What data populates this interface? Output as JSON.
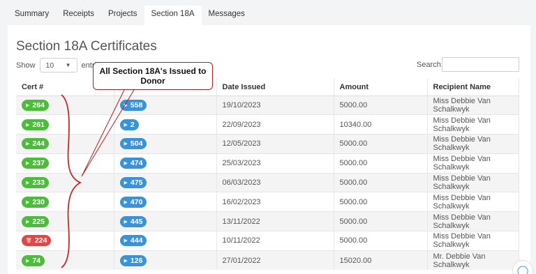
{
  "tabs": [
    {
      "label": "Summary"
    },
    {
      "label": "Receipts"
    },
    {
      "label": "Projects"
    },
    {
      "label": "Section 18A"
    },
    {
      "label": "Messages"
    }
  ],
  "page_title": "Section 18A Certificates",
  "length": {
    "show_label": "Show",
    "selected": "10",
    "entries_label": "entries"
  },
  "search": {
    "label": "Search:",
    "value": ""
  },
  "callout": {
    "line1": "All Section 18A's Issued to",
    "line2": "Donor"
  },
  "table": {
    "columns": [
      "Cert #",
      "",
      "Date Issued",
      "Amount",
      "Recipient Name"
    ],
    "rows": [
      {
        "cert": "264",
        "cert_color": "green",
        "ref": "558",
        "date": "19/10/2023",
        "amount": "5000.00",
        "recipient": "Miss Debbie Van Schalkwyk"
      },
      {
        "cert": "261",
        "cert_color": "green",
        "ref": "2",
        "date": "22/09/2023",
        "amount": "10340.00",
        "recipient": "Miss Debbie Van Schalkwyk"
      },
      {
        "cert": "244",
        "cert_color": "green",
        "ref": "504",
        "date": "12/05/2023",
        "amount": "5000.00",
        "recipient": "Miss Debbie Van Schalkwyk"
      },
      {
        "cert": "237",
        "cert_color": "green",
        "ref": "474",
        "date": "25/03/2023",
        "amount": "5000.00",
        "recipient": "Miss Debbie Van Schalkwyk"
      },
      {
        "cert": "233",
        "cert_color": "green",
        "ref": "475",
        "date": "06/03/2023",
        "amount": "5000.00",
        "recipient": "Miss Debbie Van Schalkwyk"
      },
      {
        "cert": "230",
        "cert_color": "green",
        "ref": "470",
        "date": "16/02/2023",
        "amount": "5000.00",
        "recipient": "Miss Debbie Van Schalkwyk"
      },
      {
        "cert": "225",
        "cert_color": "green",
        "ref": "445",
        "date": "13/11/2022",
        "amount": "5000.00",
        "recipient": "Miss Debbie Van Schalkwyk"
      },
      {
        "cert": "224",
        "cert_color": "red",
        "ref": "444",
        "date": "10/11/2022",
        "amount": "5000.00",
        "recipient": "Miss Debbie Van Schalkwyk"
      },
      {
        "cert": "74",
        "cert_color": "green",
        "ref": "126",
        "date": "27/01/2022",
        "amount": "15020.00",
        "recipient": "Mr. Debbie Van Schalkwyk"
      }
    ]
  },
  "icons": {
    "play": "play-icon",
    "trash": "trash-icon",
    "chat": "chat-icon",
    "chevron": "chevron-down-icon"
  },
  "colors": {
    "green": "#4cbd3a",
    "blue": "#3a93d9",
    "red": "#e04848",
    "annotation": "#b71c1c"
  }
}
